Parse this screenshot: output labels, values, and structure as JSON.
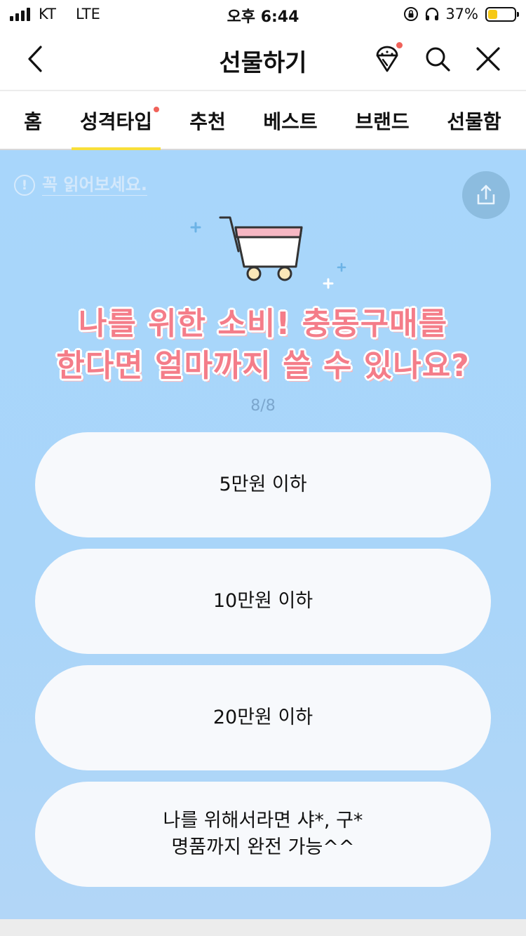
{
  "status_bar": {
    "carrier": "KT",
    "network": "LTE",
    "time": "오후 6:44",
    "battery_percent": "37%",
    "battery_level": 0.37
  },
  "header": {
    "title": "선물하기"
  },
  "tabs": [
    {
      "label": "홈",
      "active": false,
      "dot": false
    },
    {
      "label": "성격타입",
      "active": true,
      "dot": true
    },
    {
      "label": "추천",
      "active": false,
      "dot": false
    },
    {
      "label": "베스트",
      "active": false,
      "dot": false
    },
    {
      "label": "브랜드",
      "active": false,
      "dot": false
    },
    {
      "label": "선물함",
      "active": false,
      "dot": false
    }
  ],
  "notice": {
    "icon_text": "!",
    "text": "꼭 읽어보세요."
  },
  "quiz": {
    "question_line1": "나를 위한 소비! 충동구매를",
    "question_line2": "한다면 얼마까지 쓸 수 있나요?",
    "progress": "8/8",
    "options": [
      {
        "line1": "5만원 이하",
        "line2": ""
      },
      {
        "line1": "10만원 이하",
        "line2": ""
      },
      {
        "line1": "20만원 이하",
        "line2": ""
      },
      {
        "line1": "나를 위해서라면 샤*, 구*",
        "line2": "명품까지 완전 가능^^"
      }
    ]
  },
  "colors": {
    "accent_yellow": "#f8df3a",
    "notification_red": "#f0625a",
    "background_blue": "#a8d6fb",
    "question_pink": "#f47d89"
  },
  "icons": [
    "back-icon",
    "gift-icon",
    "search-icon",
    "close-icon",
    "share-icon",
    "info-icon",
    "cart-illustration"
  ]
}
